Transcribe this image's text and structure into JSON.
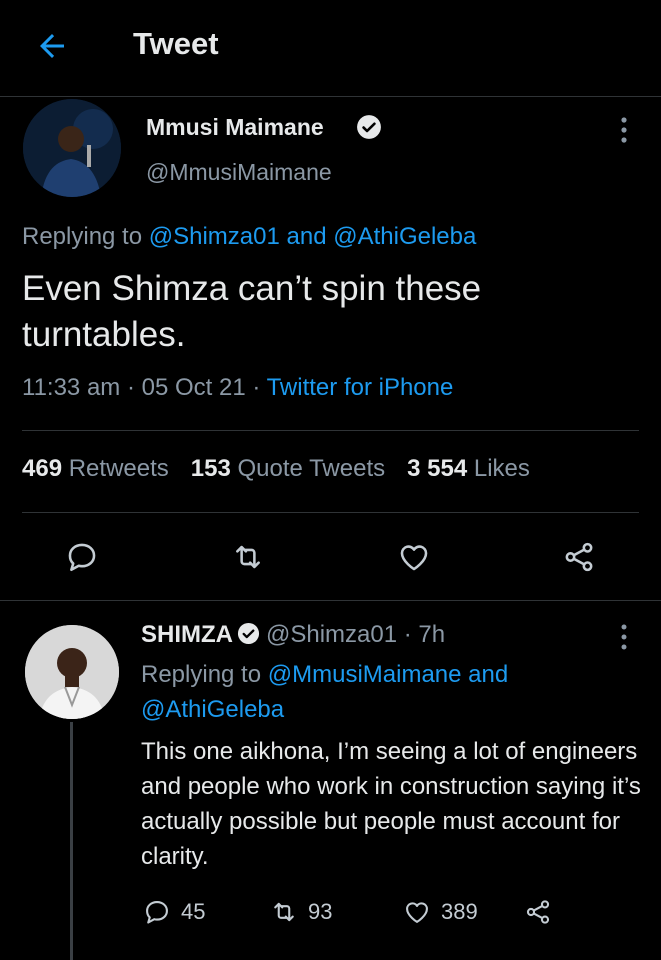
{
  "header": {
    "title": "Tweet"
  },
  "main_tweet": {
    "author_name": "Mmusi Maimane",
    "handle": "@MmusiMaimane",
    "replying_prefix": "Replying to ",
    "replying_user1": "@Shimza01",
    "replying_and": " and ",
    "replying_user2": "@AthiGeleba",
    "text": "Even Shimza can’t spin these turntables.",
    "time": "11:33 am",
    "sep": " · ",
    "date": "05 Oct 21",
    "source": "Twitter for iPhone",
    "stats": {
      "retweets_count": "469",
      "retweets_label": " Retweets",
      "quotes_count": "153",
      "quotes_label": " Quote Tweets",
      "likes_count": "3 554",
      "likes_label": " Likes"
    }
  },
  "reply_tweet": {
    "author_name": "SHIMZA",
    "handle": "@Shimza01",
    "time_ago": " · 7h",
    "replying_prefix": "Replying to ",
    "replying_user1": "@MmusiMaimane",
    "replying_and": " and ",
    "replying_user2": "@AthiGeleba",
    "text": "This one aikhona, I’m seeing a lot of engineers and people who work in construction saying it’s actually possible but people must account for clarity.",
    "reply_count": "45",
    "retweet_count": "93",
    "like_count": "389"
  },
  "colors": {
    "accent": "#1d9bf0",
    "background": "#000000",
    "muted": "#8b98a5"
  },
  "icons": [
    "back-arrow-icon",
    "verified-badge-icon",
    "more-icon",
    "reply-icon",
    "retweet-icon",
    "like-icon",
    "share-icon"
  ]
}
